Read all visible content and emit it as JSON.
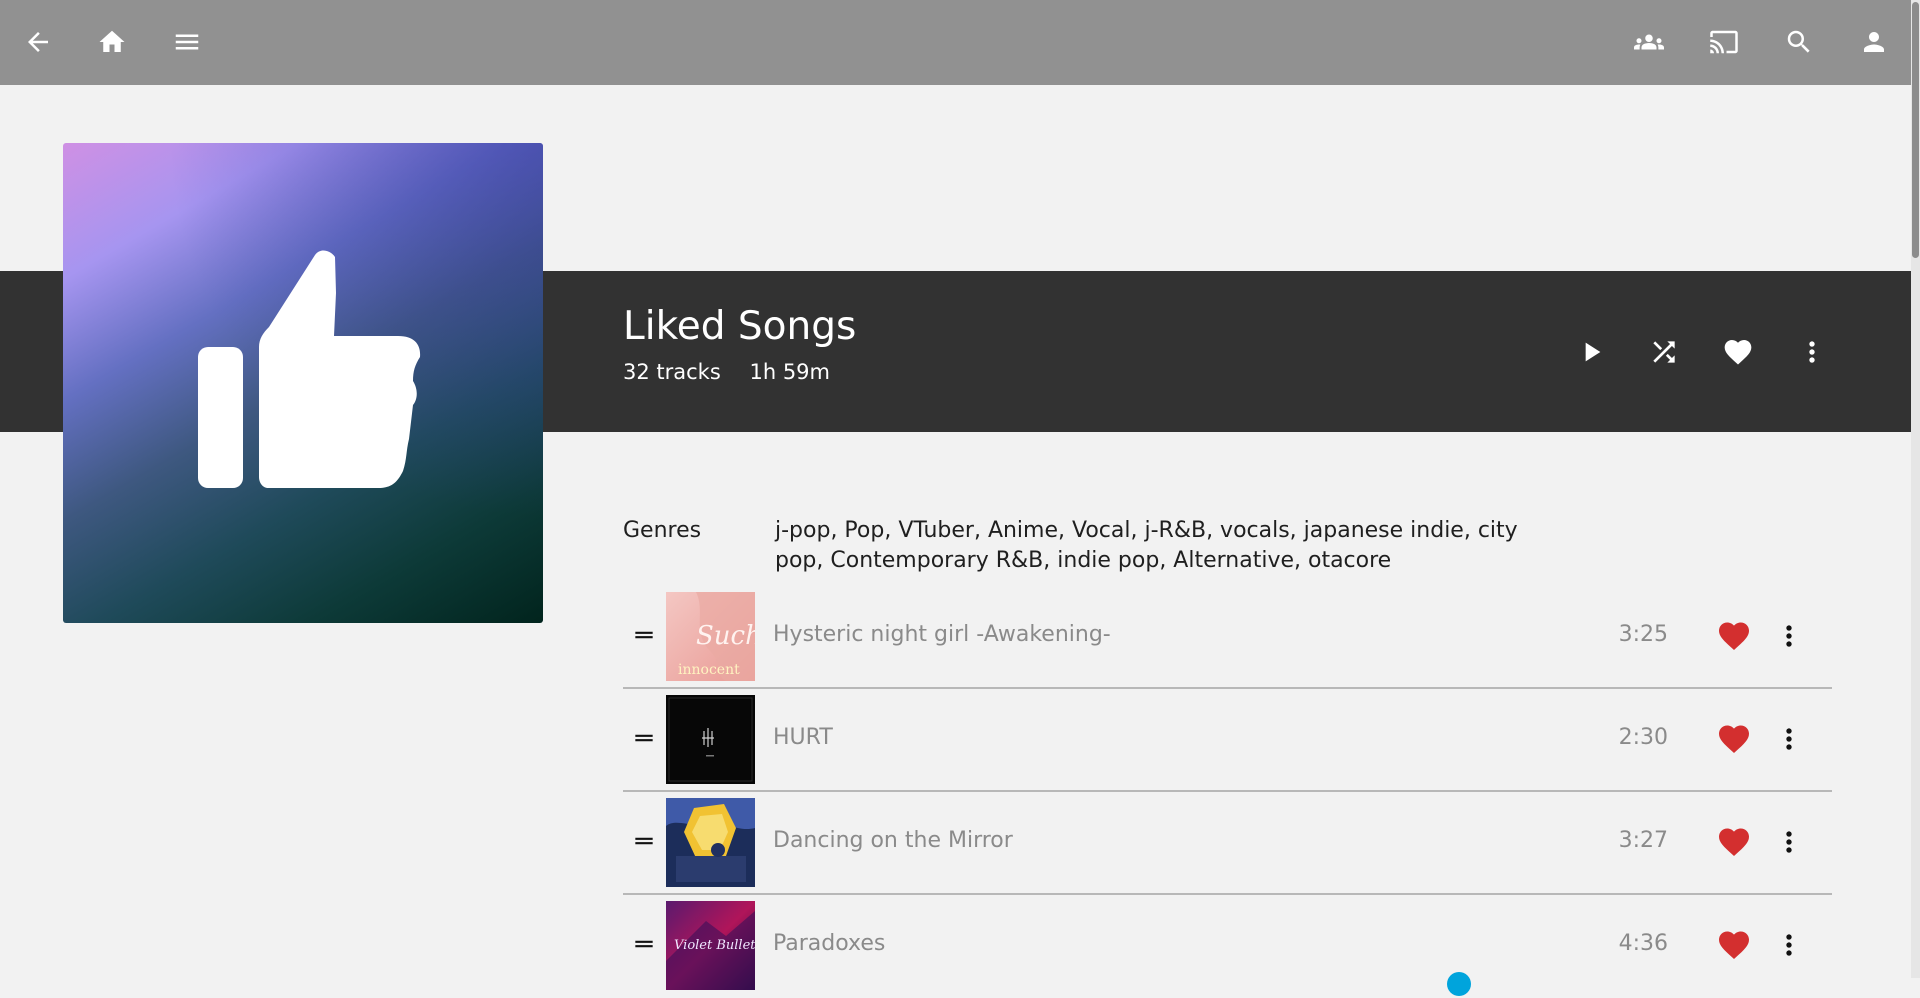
{
  "topbar": {
    "back_icon": "arrow-back-icon",
    "home_icon": "home-icon",
    "menu_icon": "hamburger-menu-icon",
    "syncplay_icon": "group-icon",
    "cast_icon": "cast-icon",
    "search_icon": "search-icon",
    "user_icon": "person-icon"
  },
  "playlist": {
    "title": "Liked Songs",
    "track_count": "32 tracks",
    "duration": "1h 59m",
    "cover_icon": "thumb-up-icon",
    "actions": {
      "play_icon": "play-icon",
      "shuffle_icon": "shuffle-icon",
      "favorite_icon": "heart-icon",
      "more_icon": "more-vertical-icon"
    }
  },
  "genres": {
    "label": "Genres",
    "value": "j-pop, Pop, VTuber, Anime, Vocal, j-R&B, vocals, japanese indie, city pop, Contemporary R&B, indie pop, Alternative, otacore"
  },
  "tracks": [
    {
      "name": "Hysteric night girl -Awakening-",
      "duration": "3:25",
      "favorite": true,
      "thumb_text": "Such",
      "thumb_subtext": "innocent"
    },
    {
      "name": "HURT",
      "duration": "2:30",
      "favorite": true
    },
    {
      "name": "Dancing on the Mirror",
      "duration": "3:27",
      "favorite": true
    },
    {
      "name": "Paradoxes",
      "duration": "4:36",
      "favorite": true,
      "thumb_text": "Violet Bullet"
    }
  ],
  "colors": {
    "topbar": "#919191",
    "hero_band": "#323232",
    "background": "#f2f2f2",
    "favorite": "#d32f2f",
    "accent": "#00a4dc"
  }
}
